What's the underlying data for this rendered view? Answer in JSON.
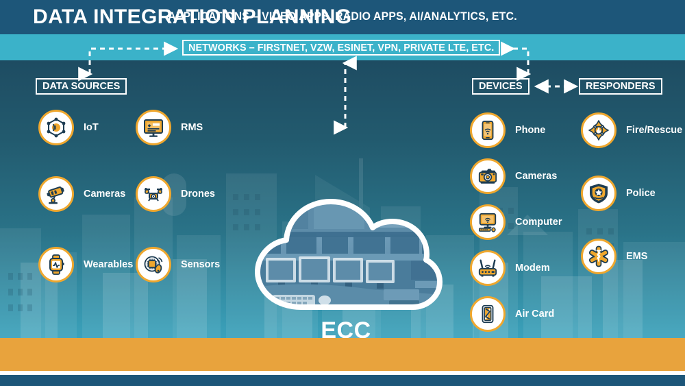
{
  "header": {
    "title": "DATA INTEGRATION PLANNING"
  },
  "networks": {
    "label": "NETWORKS – FIRSTNET, VZW, ESINET, VPN, PRIVATE LTE, ETC."
  },
  "sections": {
    "data_sources_label": "DATA SOURCES",
    "devices_label": "DEVICES",
    "responders_label": "RESPONDERS"
  },
  "center": {
    "label": "ECC",
    "image_alt": "emergency communications center dispatch room"
  },
  "data_sources": [
    {
      "label": "IoT",
      "icon": "iot-mesh-icon"
    },
    {
      "label": "RMS",
      "icon": "monitor-records-icon"
    },
    {
      "label": "Cameras",
      "icon": "cctv-camera-icon"
    },
    {
      "label": "Drones",
      "icon": "drone-icon"
    },
    {
      "label": "Wearables",
      "icon": "smartwatch-icon"
    },
    {
      "label": "Sensors",
      "icon": "sensor-chip-icon"
    }
  ],
  "devices": [
    {
      "label": "Phone",
      "icon": "smartphone-icon"
    },
    {
      "label": "Cameras",
      "icon": "photo-camera-icon"
    },
    {
      "label": "Computer",
      "icon": "desktop-computer-icon"
    },
    {
      "label": "Modem",
      "icon": "router-modem-icon"
    },
    {
      "label": "Air Card",
      "icon": "air-card-icon"
    }
  ],
  "responders": [
    {
      "label": "Fire/Rescue",
      "icon": "fire-maltese-cross-icon"
    },
    {
      "label": "Police",
      "icon": "police-shield-badge-icon"
    },
    {
      "label": "EMS",
      "icon": "star-of-life-icon"
    }
  ],
  "applications": {
    "label": "APPLICATIONS – VIDEO APPS, RADIO APPS, AI/ANALYTICS, ETC."
  },
  "colors": {
    "header_blue": "#1d5679",
    "networks_teal": "#3bb2c9",
    "stage_top": "#1e4c62",
    "stage_bottom": "#3ba2bb",
    "accent_orange": "#efa72e",
    "apps_bar": "#e8a33d",
    "icon_navy": "#1d3c52",
    "white": "#ffffff"
  }
}
